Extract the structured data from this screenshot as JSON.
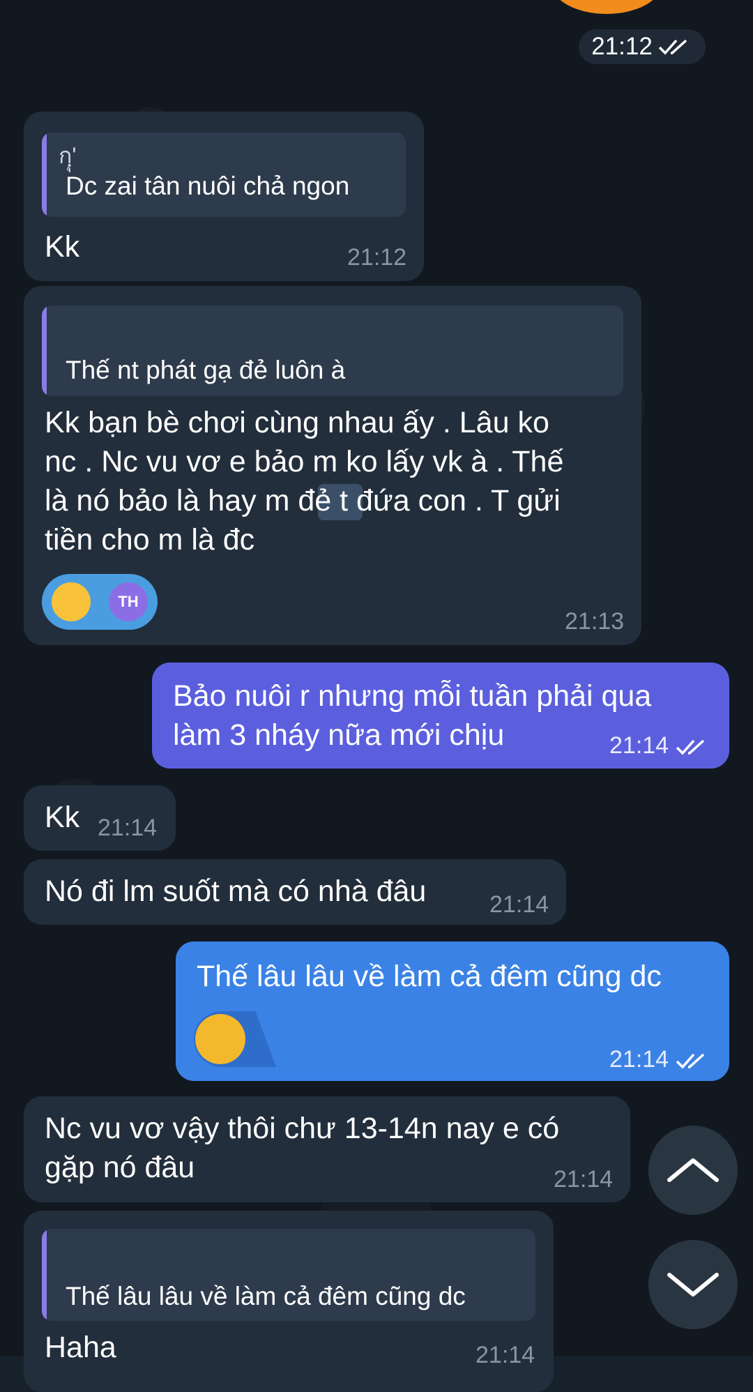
{
  "date_pill": {
    "time": "21:12"
  },
  "messages": [
    {
      "reply": {
        "author": "กฺุ'",
        "text": "Dc zai tân nuôi chả ngon"
      },
      "text": "Kk",
      "time": "21:12"
    },
    {
      "reply": {
        "author": "",
        "text": "Thế nt phát gạ đẻ luôn à"
      },
      "text": "Kk bạn bè chơi cùng nhau ấy . Lâu ko\nnc . Nc vu vơ e bảo m ko lấy vk à . Thế\nlà nó bảo là hay m đẻ t đứa con . T gửi\ntiền cho m là đc",
      "reaction": {
        "avatar_initials": "TH"
      },
      "time": "21:13"
    },
    {
      "text": "Bảo nuôi r nhưng mỗi tuần phải qua\nlàm 3 nháy nữa mới chịu",
      "time": "21:14"
    },
    {
      "text": "Kk",
      "time": "21:14"
    },
    {
      "text": "Nó đi lm suốt mà có nhà đâu",
      "time": "21:14"
    },
    {
      "text": "Thế lâu lâu về làm cả đêm cũng dc",
      "time": "21:14"
    },
    {
      "text": "Nc vu vơ vậy thôi chư 13-14n nay e có\ngặp nó đâu",
      "time": "21:14"
    },
    {
      "reply": {
        "author": "",
        "text": "Thế lâu lâu về làm cả đêm cũng dc"
      },
      "text": "Haha",
      "time": "21:14"
    }
  ],
  "colors": {
    "background": "#111820",
    "incoming_bubble": "#222e3b",
    "outgoing_purple": "#5b5fde",
    "outgoing_blue": "#3b82e6"
  },
  "icons": {
    "read_checks": "double-check-icon",
    "scroll_up": "chevron-up-icon",
    "scroll_down": "chevron-down-icon"
  }
}
